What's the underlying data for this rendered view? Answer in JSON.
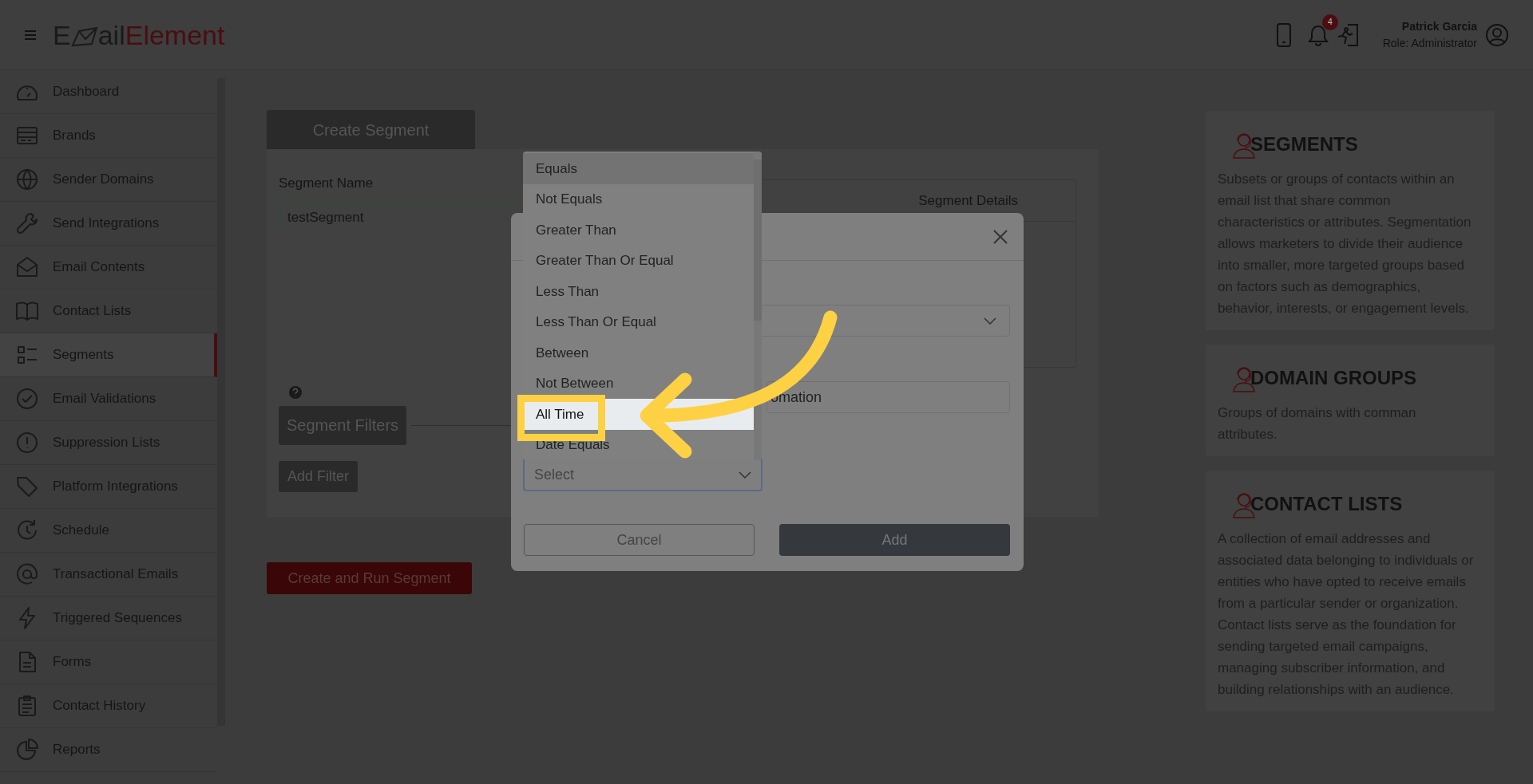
{
  "header": {
    "logo": {
      "part_1": "E",
      "part_2": "ail",
      "part_3": "Element"
    },
    "notification_count": "4",
    "user": {
      "name": "Patrick Garcia",
      "role": "Role: Administrator"
    }
  },
  "sidebar": {
    "items": [
      {
        "label": "Dashboard",
        "selected": false
      },
      {
        "label": "Brands",
        "selected": false
      },
      {
        "label": "Sender Domains",
        "selected": false
      },
      {
        "label": "Send Integrations",
        "selected": false
      },
      {
        "label": "Email Contents",
        "selected": false
      },
      {
        "label": "Contact Lists",
        "selected": false
      },
      {
        "label": "Segments",
        "selected": true
      },
      {
        "label": "Email Validations",
        "selected": false
      },
      {
        "label": "Suppression Lists",
        "selected": false
      },
      {
        "label": "Platform Integrations",
        "selected": false
      },
      {
        "label": "Schedule",
        "selected": false
      },
      {
        "label": "Transactional Emails",
        "selected": false
      },
      {
        "label": "Triggered Sequences",
        "selected": false
      },
      {
        "label": "Forms",
        "selected": false
      },
      {
        "label": "Contact History",
        "selected": false
      },
      {
        "label": "Reports",
        "selected": false
      }
    ]
  },
  "form": {
    "tab": "Create Segment",
    "segment_name_label": "Segment Name",
    "segment_name_value": "testSegment",
    "details_heading": "Segment Details",
    "filters_button": "Segment Filters",
    "add_filter_button": "Add Filter",
    "submit_button": "Create and Run Segment"
  },
  "modal": {
    "text_value": "omation",
    "select_placeholder": "Select",
    "cancel_button": "Cancel",
    "add_button": "Add"
  },
  "dropdown": {
    "options": [
      {
        "label": "Equals",
        "hovered": true,
        "selected": false
      },
      {
        "label": "Not Equals",
        "hovered": false,
        "selected": false
      },
      {
        "label": "Greater Than",
        "hovered": false,
        "selected": false
      },
      {
        "label": "Greater Than Or Equal",
        "hovered": false,
        "selected": false
      },
      {
        "label": "Less Than",
        "hovered": false,
        "selected": false
      },
      {
        "label": "Less Than Or Equal",
        "hovered": false,
        "selected": false
      },
      {
        "label": "Between",
        "hovered": false,
        "selected": false
      },
      {
        "label": "Not Between",
        "hovered": false,
        "selected": false
      },
      {
        "label": "All Time",
        "hovered": false,
        "selected": true
      },
      {
        "label": "Date Equals",
        "hovered": false,
        "selected": false
      }
    ]
  },
  "info_cards": [
    {
      "title": "SEGMENTS",
      "text": "Subsets or groups of contacts within an email list that share common characteristics or attributes. Segmentation allows marketers to divide their audience into smaller, more targeted groups based on factors such as demographics, behavior, interests, or engagement levels."
    },
    {
      "title": "DOMAIN GROUPS",
      "text": "Groups of domains with comman attributes."
    },
    {
      "title": "CONTACT LISTS",
      "text": "A collection of email addresses and associated data belonging to individuals or entities who have opted to receive emails from a particular sender or organization. Contact lists serve as the foundation for sending targeted email campaigns, managing subscriber information, and building relationships with an audience."
    }
  ]
}
